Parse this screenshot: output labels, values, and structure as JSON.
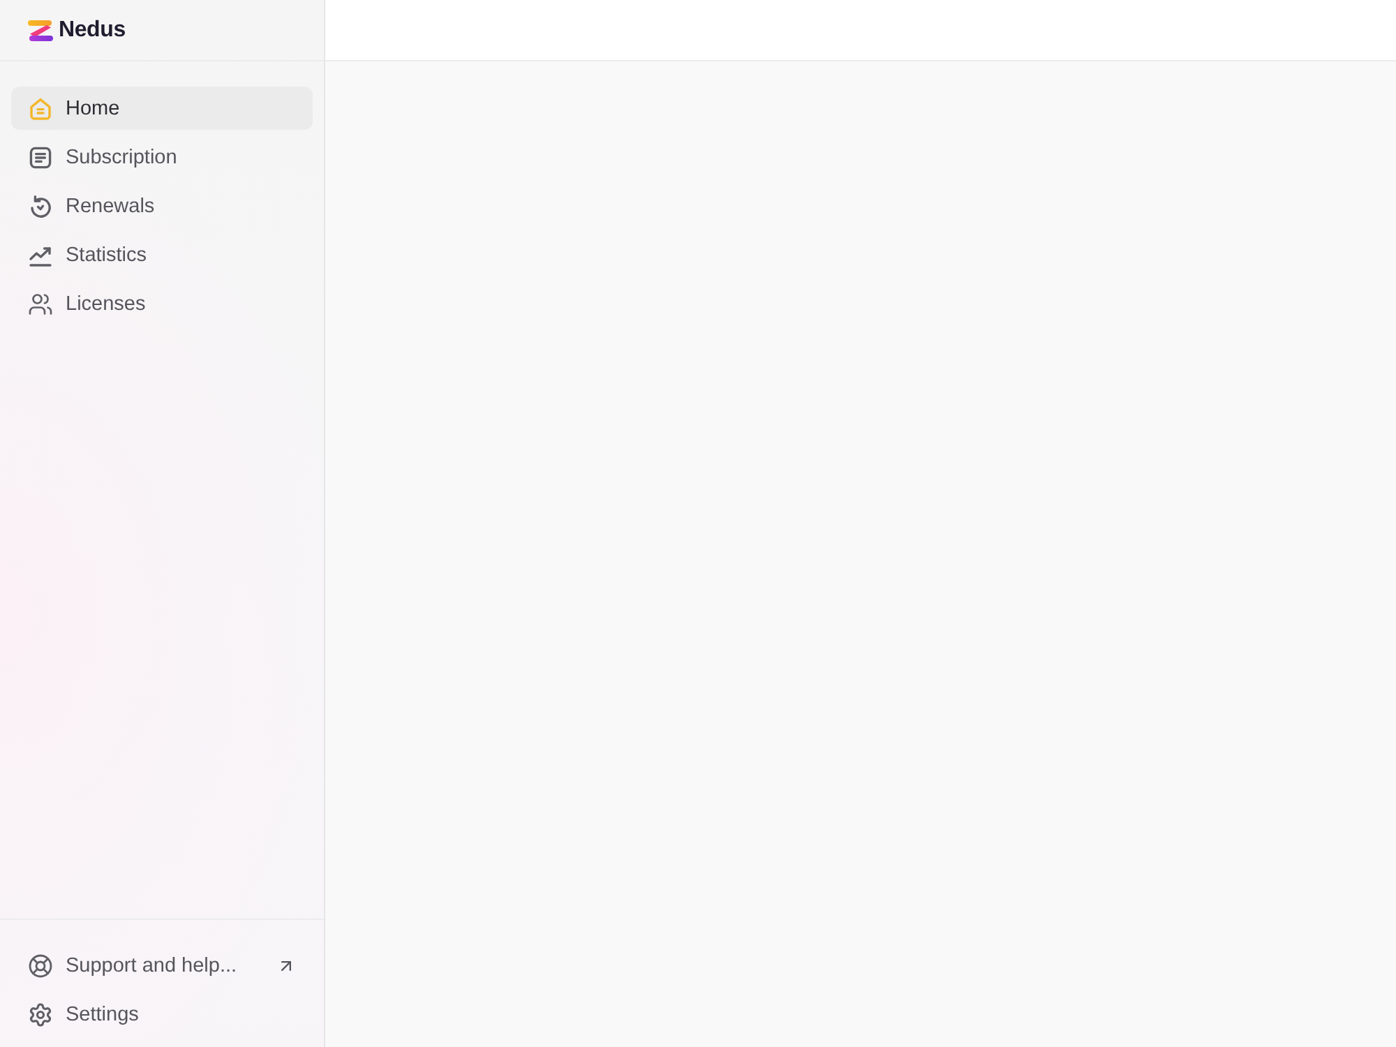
{
  "sidebar": {
    "brand": "Nedus",
    "nav_items": [
      {
        "label": "Home",
        "selected": true
      },
      {
        "label": "Subscription",
        "selected": false
      },
      {
        "label": "Renewals",
        "selected": false
      },
      {
        "label": "Statistics",
        "selected": false
      },
      {
        "label": "Licenses",
        "selected": false
      }
    ],
    "footer_items": [
      {
        "label": "Support and help...",
        "external": true
      },
      {
        "label": "Settings",
        "external": false
      }
    ]
  }
}
